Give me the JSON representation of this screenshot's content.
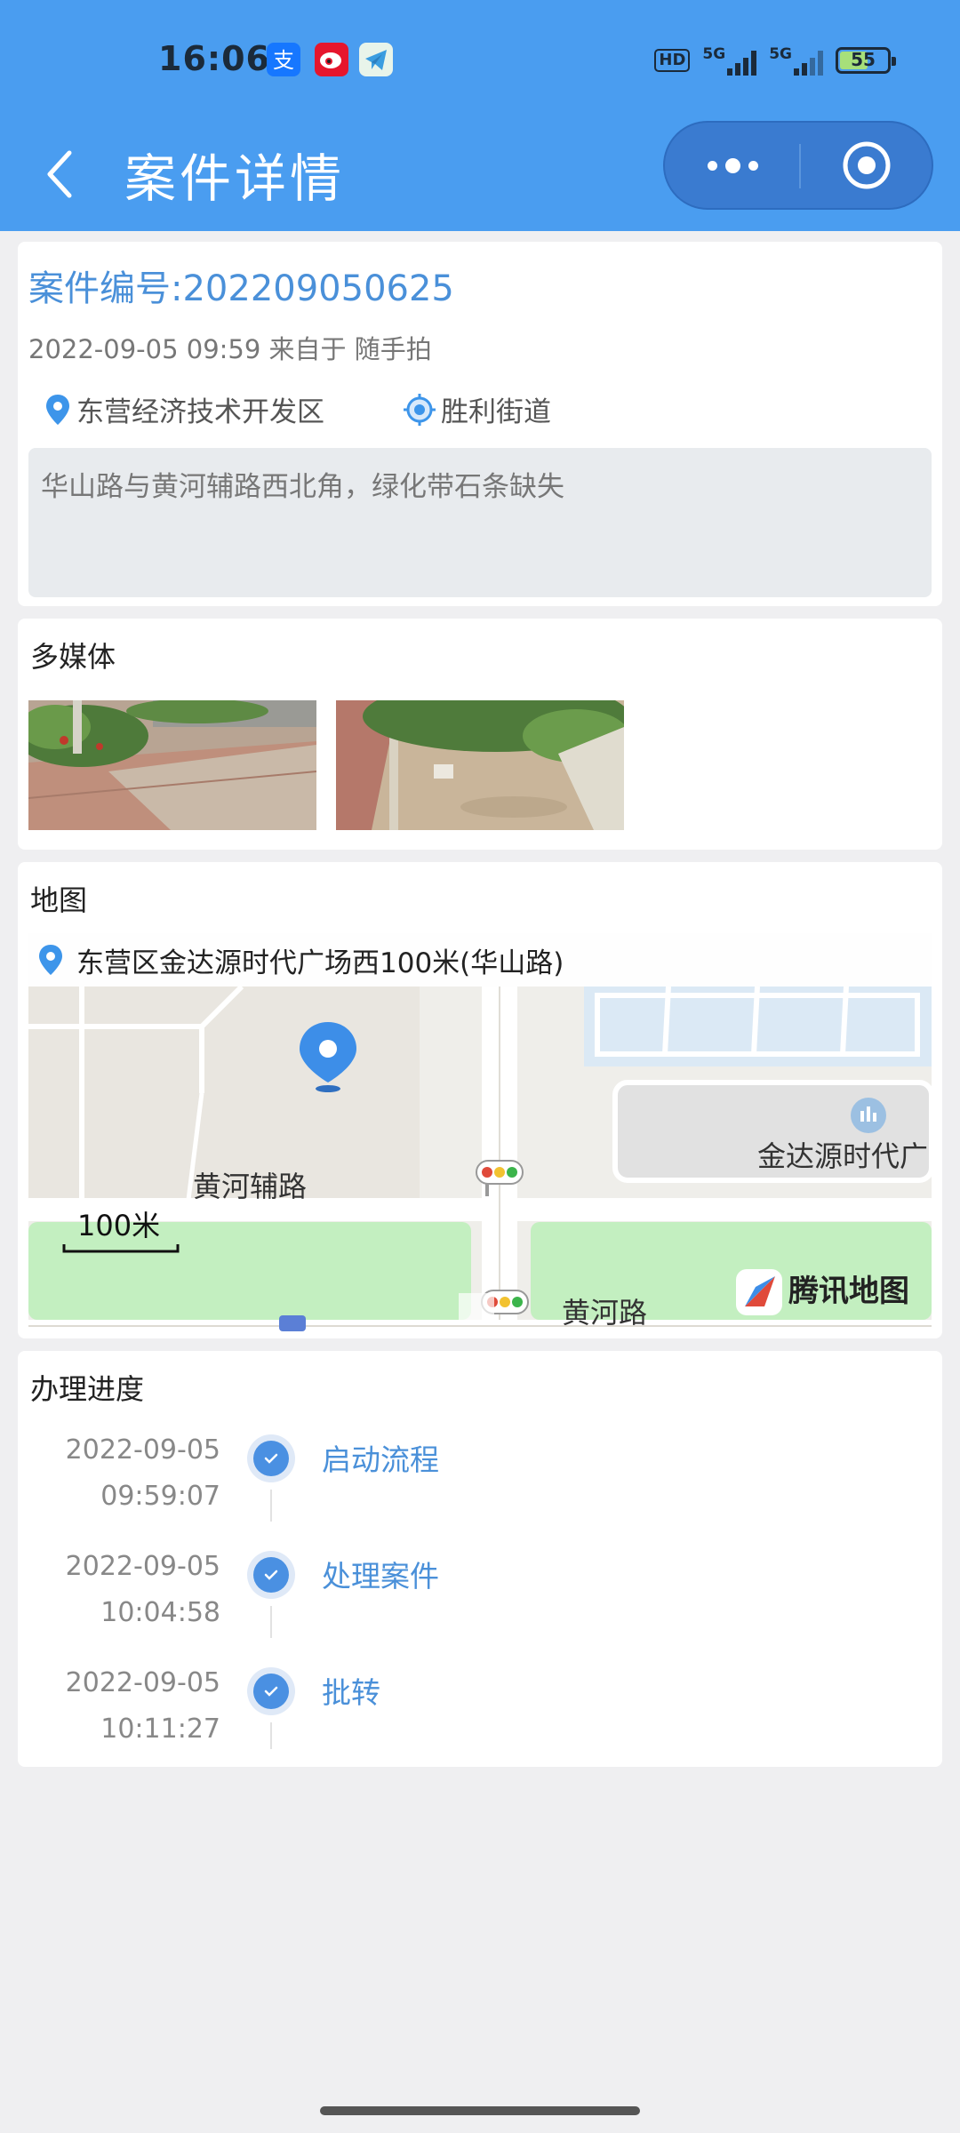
{
  "status_bar": {
    "time": "16:06",
    "network_left": "5G",
    "network_right": "5G",
    "hd_badge": "HD",
    "battery": "55",
    "battery_level": 0.55,
    "app_icons": [
      "alipay-icon",
      "weibo-icon",
      "telegram-icon"
    ]
  },
  "header": {
    "title": "案件详情",
    "back_icon": "chevron-left-icon",
    "more_icon": "more-dots-icon",
    "close_icon": "target-close-icon"
  },
  "case": {
    "number": "案件编号:202209050625",
    "meta": "2022-09-05 09:59 来自于 随手拍",
    "district": "东营经济技术开发区",
    "street": "胜利街道",
    "description": "华山路与黄河辅路西北角，绿化带石条缺失"
  },
  "media": {
    "title": "多媒体",
    "photos": [
      "photo-1",
      "photo-2"
    ]
  },
  "map": {
    "title": "地图",
    "address": "东营区金达源时代广场西100米(华山路)",
    "labels": {
      "road1": "黄河辅路",
      "road2": "黄河路",
      "poi": "金达源时代广",
      "scale": "100米",
      "brand": "腾讯地图"
    }
  },
  "progress": {
    "title": "办理进度",
    "items": [
      {
        "date": "2022-09-05",
        "time": "09:59:07",
        "label": "启动流程"
      },
      {
        "date": "2022-09-05",
        "time": "10:04:58",
        "label": "处理案件"
      },
      {
        "date": "2022-09-05",
        "time": "10:11:27",
        "label": "批转"
      }
    ]
  },
  "colors": {
    "primary": "#4a9df0",
    "link": "#4a90d9",
    "background": "#efeff1"
  }
}
